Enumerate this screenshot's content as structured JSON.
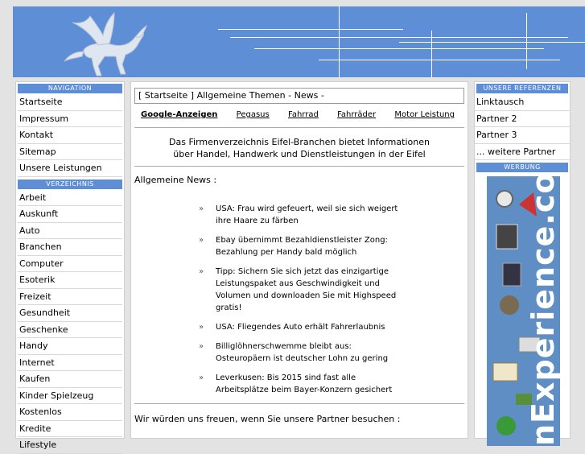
{
  "left": {
    "navigation_title": "NAVIGATION",
    "navigation": [
      "Startseite",
      "Impressum",
      "Kontakt",
      "Sitemap",
      "Unsere Leistungen"
    ],
    "directory_title": "VERZEICHNIS",
    "directory": [
      "Arbeit",
      "Auskunft",
      "Auto",
      "Branchen",
      "Computer",
      "Esoterik",
      "Freizeit",
      "Gesundheit",
      "Geschenke",
      "Handy",
      "Internet",
      "Kaufen",
      "Kinder Spielzeug",
      "Kostenlos",
      "Kredite",
      "Lifestyle"
    ]
  },
  "main": {
    "breadcrumb": "[ Startseite ] Allgemeine Themen - News -",
    "topnav": [
      "Google-Anzeigen",
      "Pegasus",
      "Fahrrad",
      "Fahrräder",
      "Motor Leistung"
    ],
    "intro_line1": "Das Firmenverzeichnis Eifel-Branchen bietet Informationen",
    "intro_line2": "über Handel, Handwerk und Dienstleistungen in der Eifel",
    "news_heading": "Allgemeine News :",
    "bullet": "»",
    "news": [
      "USA: Frau wird gefeuert, weil sie sich weigert ihre Haare zu färben",
      "Ebay übernimmt Bezahldienstleister Zong: Bezahlung per Handy bald möglich",
      "Tipp: Sichern Sie sich jetzt das einzigartige Leistungspaket aus Geschwindigkeit und Volumen und downloaden Sie mit Highspeed gratis!",
      "USA: Fliegendes Auto erhält Fahrerlaubnis",
      "Billiglöhnerschwemme bleibt aus: Osteuropäern ist deutscher Lohn zu gering",
      "Leverkusen: Bis 2015 sind fast alle Arbeitsplätze beim Bayer-Konzern gesichert"
    ],
    "partner_text": "Wir würden uns freuen, wenn Sie unsere Partner besuchen :"
  },
  "right": {
    "references_title": "UNSERE REFERENZEN",
    "references": [
      "Linktausch",
      "Partner 2",
      "Partner 3",
      "... weitere Partner"
    ],
    "ad_title": "WERBUNG",
    "ad_text": "nExperience.com"
  },
  "colors": {
    "accent": "#5e8fd6",
    "background": "#e3e3e3"
  }
}
